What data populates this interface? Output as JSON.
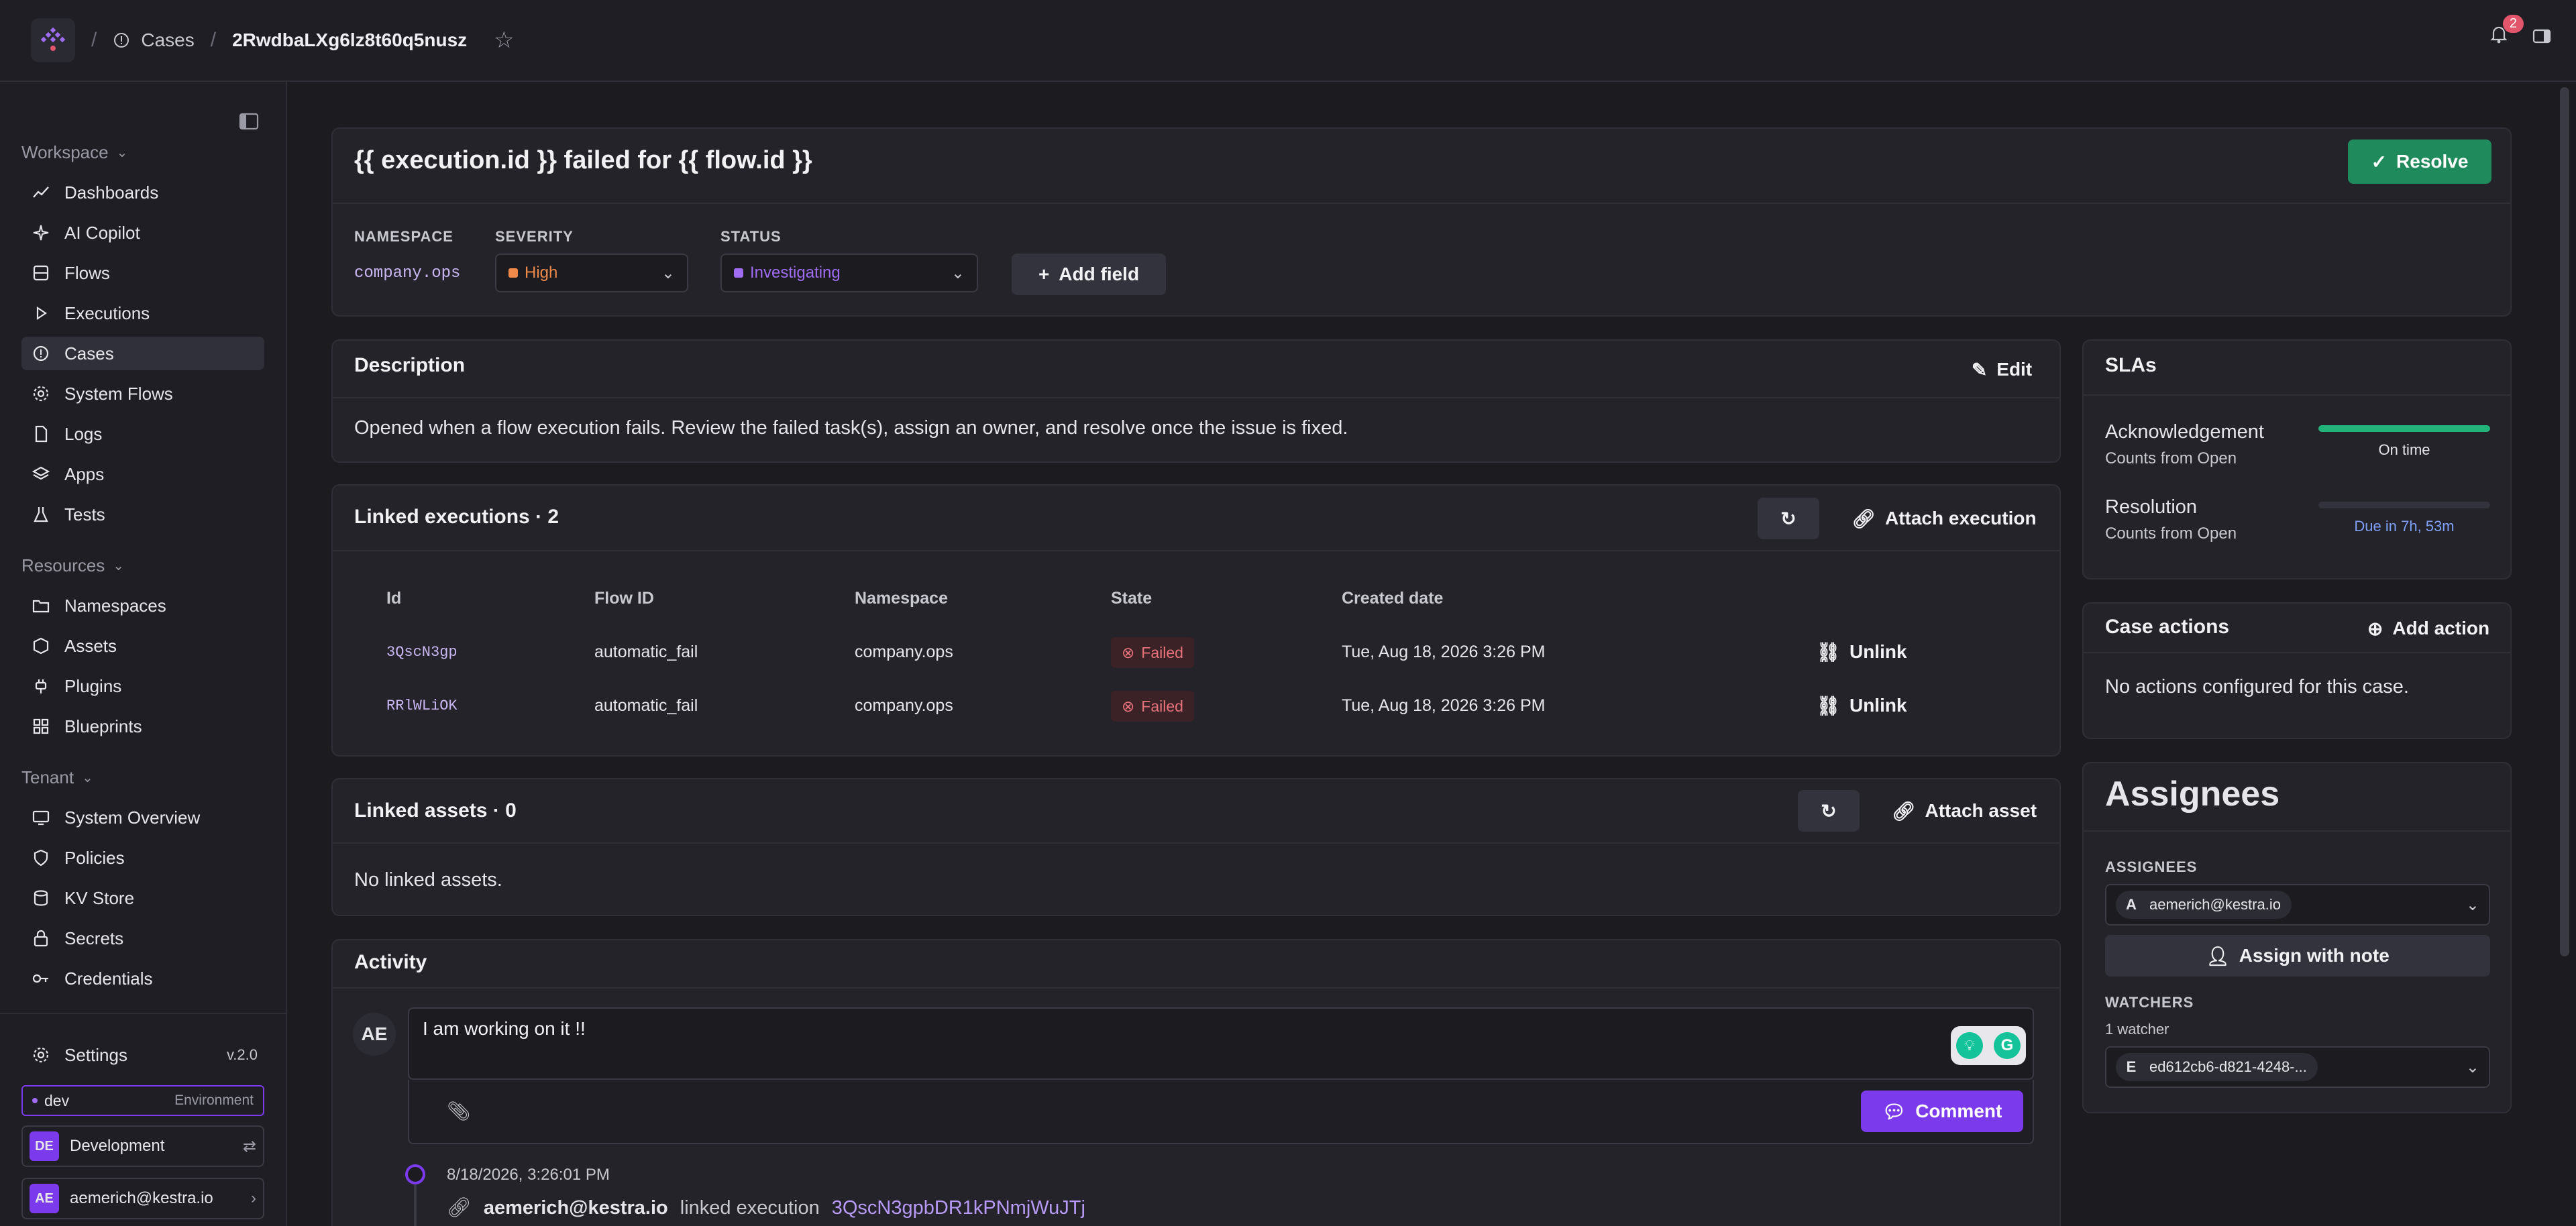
{
  "breadcrumb": {
    "cases": "Cases",
    "case_id": "2RwdbaLXg6lz8t60q5nusz"
  },
  "notifications": {
    "count": "2"
  },
  "sidebar": {
    "workspace_label": "Workspace",
    "workspace_items": [
      "Dashboards",
      "AI Copilot",
      "Flows",
      "Executions",
      "Cases",
      "System Flows",
      "Logs",
      "Apps",
      "Tests"
    ],
    "resources_label": "Resources",
    "resources_items": [
      "Namespaces",
      "Assets",
      "Plugins",
      "Blueprints"
    ],
    "tenant_label": "Tenant",
    "tenant_items": [
      "System Overview",
      "Policies",
      "KV Store",
      "Secrets",
      "Credentials"
    ],
    "settings_label": "Settings",
    "version": "v.2.0",
    "env_value": "dev",
    "env_label": "Environment",
    "tenant_initials": "DE",
    "tenant_name": "Development",
    "user_initials": "AE",
    "user_email": "aemerich@kestra.io"
  },
  "header": {
    "title": "{{ execution.id }} failed for {{ flow.id }}",
    "resolve_label": "Resolve",
    "namespace_label": "NAMESPACE",
    "namespace_value": "company.ops",
    "severity_label": "SEVERITY",
    "severity_value": "High",
    "status_label": "STATUS",
    "status_value": "Investigating",
    "add_field_label": "Add field"
  },
  "description": {
    "title": "Description",
    "edit_label": "Edit",
    "text": "Opened when a flow execution fails. Review the failed task(s), assign an owner, and resolve once the issue is fixed."
  },
  "linked_executions": {
    "title": "Linked executions · 2",
    "attach_label": "Attach execution",
    "columns": [
      "Id",
      "Flow ID",
      "Namespace",
      "State",
      "Created date"
    ],
    "rows": [
      {
        "id": "3QscN3gp",
        "flow": "automatic_fail",
        "namespace": "company.ops",
        "state": "Failed",
        "created": "Tue, Aug 18, 2026 3:26 PM",
        "action": "Unlink"
      },
      {
        "id": "RRlWLiOK",
        "flow": "automatic_fail",
        "namespace": "company.ops",
        "state": "Failed",
        "created": "Tue, Aug 18, 2026 3:26 PM",
        "action": "Unlink"
      }
    ]
  },
  "linked_assets": {
    "title": "Linked assets · 0",
    "attach_label": "Attach asset",
    "empty": "No linked assets."
  },
  "activity": {
    "title": "Activity",
    "avatar": "AE",
    "comment_text": "I am working on it !!",
    "comment_label": "Comment",
    "event_time": "8/18/2026, 3:26:01 PM",
    "event_user": "aemerich@kestra.io",
    "event_action": "linked execution",
    "event_target": "3QscN3gpbDR1kPNmjWuJTj"
  },
  "slas": {
    "title": "SLAs",
    "ack_title": "Acknowledgement",
    "ack_sub": "Counts from Open",
    "ack_status": "On time",
    "ack_progress": 1.0,
    "res_title": "Resolution",
    "res_sub": "Counts from Open",
    "res_status": "Due in 7h, 53m",
    "res_progress": 0.0
  },
  "case_actions": {
    "title": "Case actions",
    "add_label": "Add action",
    "empty": "No actions configured for this case."
  },
  "assignees": {
    "title": "Assignees",
    "assignees_label": "ASSIGNEES",
    "assignee_initial": "A",
    "assignee_value": "aemerich@kestra.io",
    "assign_note_label": "Assign with note",
    "watchers_label": "WATCHERS",
    "watchers_count": "1 watcher",
    "watcher_initial": "E",
    "watcher_value": "ed612cb6-d821-4248-..."
  },
  "colors": {
    "accent": "#7c3aed",
    "resolve": "#1f8a5b",
    "failed": "#e8727c",
    "severity": "#f08a4b",
    "status": "#a06cf2"
  }
}
